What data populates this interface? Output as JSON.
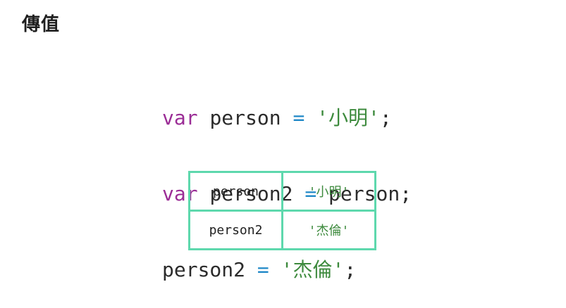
{
  "title": "傳值",
  "code": {
    "line1": {
      "keyword": "var",
      "ident": "person",
      "op": "=",
      "string": "'小明'",
      "end": ";"
    },
    "line2": {
      "keyword": "var",
      "ident": "person2",
      "op": "=",
      "rhs": "person",
      "end": ";"
    },
    "line3": {
      "ident": "person2",
      "op": "=",
      "string": "'杰倫'",
      "end": ";"
    }
  },
  "memory_table": {
    "rows": [
      {
        "name": "person",
        "value": "'小明'"
      },
      {
        "name": "person2",
        "value": "'杰倫'"
      }
    ]
  },
  "colors": {
    "keyword": "#9b2d96",
    "operator": "#1f88c7",
    "string": "#3d8a3d",
    "table_border": "#5ed8ad"
  }
}
